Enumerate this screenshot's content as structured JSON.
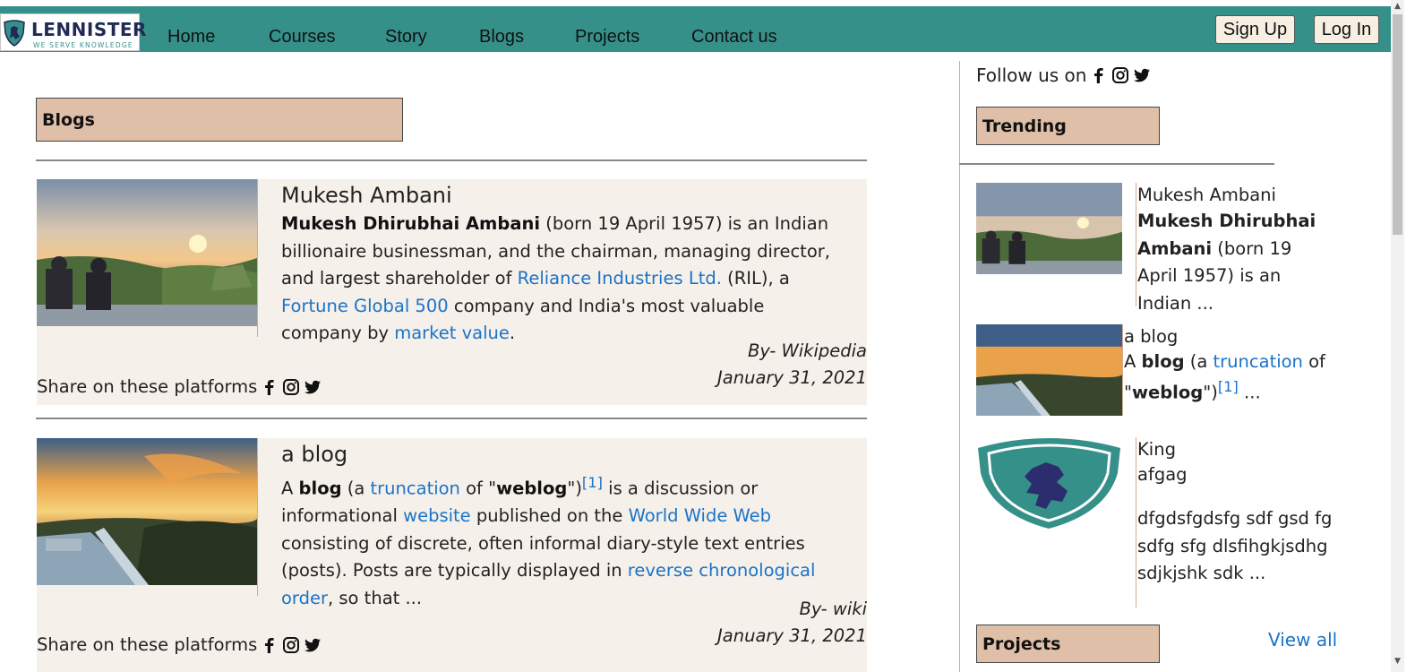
{
  "nav": {
    "logo_text": "LENNISTER",
    "logo_tagline": "WE SERVE KNOWLEDGE",
    "links": [
      "Home",
      "Courses",
      "Story",
      "Blogs",
      "Projects",
      "Contact us"
    ],
    "signup_label": "Sign Up",
    "login_label": "Log In"
  },
  "main": {
    "section_title": "Blogs",
    "posts": [
      {
        "title": "Mukesh Ambani",
        "bold_name": "Mukesh Dhirubhai Ambani",
        "text1": " (born 19 April 1957) is an Indian billionaire businessman, and the chairman, managing director, and largest shareholder of ",
        "link1": "Reliance Industries Ltd.",
        "text2": " (RIL), a ",
        "link2": "Fortune Global 500",
        "text3": " company and India's most valuable company by ",
        "link3": "market value",
        "text4": ".",
        "author": "By- Wikipedia",
        "date": "January 31, 2021",
        "share_label": "Share on these platforms"
      },
      {
        "title": "a blog",
        "text0": "A ",
        "bold1": "blog",
        "text1": " (a ",
        "link1": "truncation",
        "text2": " of \"",
        "bold2": "weblog",
        "text3": "\")",
        "footnote": "[1]",
        "text4": " is a discussion or informational ",
        "link2": "website",
        "text5": " published on the ",
        "link3": "World Wide Web",
        "text6": " consisting of discrete, often informal diary-style text entries (posts). Posts are typically displayed in ",
        "link4": "reverse chronological order",
        "text7": ", so that ...",
        "author": "By- wiki",
        "date": "January 31, 2021",
        "share_label": "Share on these platforms"
      }
    ]
  },
  "sidebar": {
    "follow_label": "Follow us on",
    "trending_title": "Trending",
    "trending": [
      {
        "title": "Mukesh Ambani",
        "bold": "Mukesh Dhirubhai Ambani",
        "text": " (born 19 April 1957) is an Indian ..."
      },
      {
        "title": "a blog",
        "text0": "A ",
        "bold1": "blog",
        "text1": " (a ",
        "link1": "truncation",
        "text2": " of \"",
        "bold2": "weblog",
        "text3": "\")",
        "footnote": "[1]",
        "text4": " ..."
      },
      {
        "title": "King",
        "subtitle": "afgag",
        "text": "dfgdsfgdsfg sdf gsd fg sdfg sfg  dlsfihgkjsdhg sdjkjshk sdk ..."
      }
    ],
    "projects_title": "Projects",
    "view_all": "View all"
  },
  "colors": {
    "nav_bg": "#36908a",
    "section_box": "#dfbfa8",
    "card_bg": "#f6f0ea",
    "link": "#1a73c8",
    "logo_navy": "#1f2a55",
    "button_bg": "#f6efe2"
  },
  "icons": [
    "facebook-icon",
    "instagram-icon",
    "twitter-icon",
    "shield-lion-icon"
  ]
}
